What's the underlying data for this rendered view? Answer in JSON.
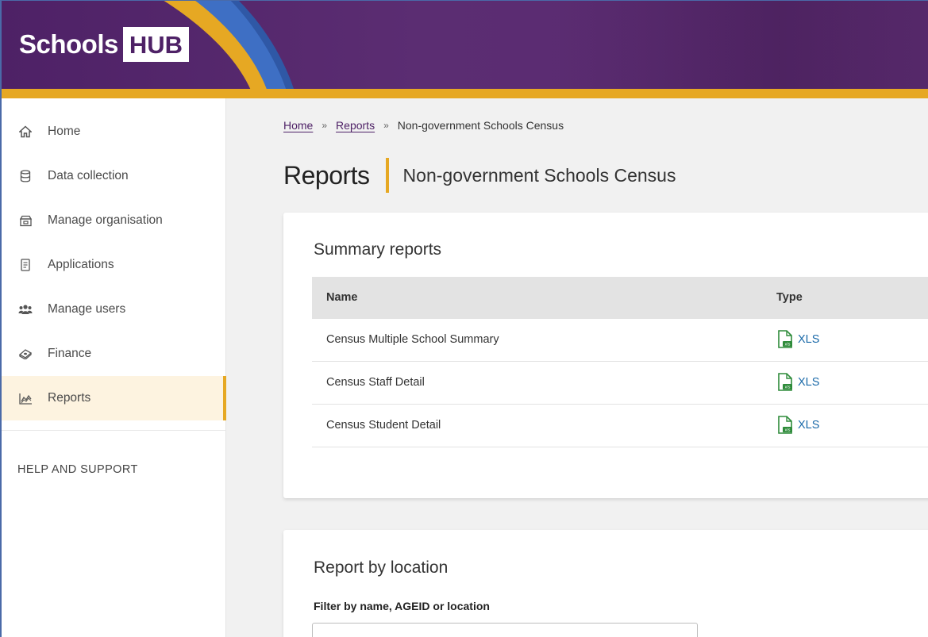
{
  "brand": {
    "name_part1": "Schools",
    "name_part2": "HUB",
    "colors": {
      "primary": "#4e2166",
      "accent": "#e6a823",
      "link": "#1b6aa9"
    }
  },
  "sidebar": {
    "items": [
      {
        "label": "Home",
        "icon": "home-icon",
        "active": false
      },
      {
        "label": "Data collection",
        "icon": "database-icon",
        "active": false
      },
      {
        "label": "Manage organisation",
        "icon": "organisation-icon",
        "active": false
      },
      {
        "label": "Applications",
        "icon": "document-icon",
        "active": false
      },
      {
        "label": "Manage users",
        "icon": "users-icon",
        "active": false
      },
      {
        "label": "Finance",
        "icon": "finance-icon",
        "active": false
      },
      {
        "label": "Reports",
        "icon": "chart-icon",
        "active": true
      }
    ],
    "help_heading": "HELP AND SUPPORT"
  },
  "breadcrumb": {
    "home": "Home",
    "reports": "Reports",
    "separator": "»",
    "current": "Non-government Schools Census"
  },
  "page": {
    "title": "Reports",
    "subtitle": "Non-government Schools Census"
  },
  "summary": {
    "title": "Summary reports",
    "columns": {
      "name": "Name",
      "type": "Type"
    },
    "rows": [
      {
        "name": "Census Multiple School Summary",
        "type": "XLS"
      },
      {
        "name": "Census Staff Detail",
        "type": "XLS"
      },
      {
        "name": "Census Student Detail",
        "type": "XLS"
      }
    ]
  },
  "location": {
    "title": "Report by location",
    "filter_label": "Filter by name, AGEID or location",
    "filter_value": "",
    "filter_placeholder": ""
  }
}
